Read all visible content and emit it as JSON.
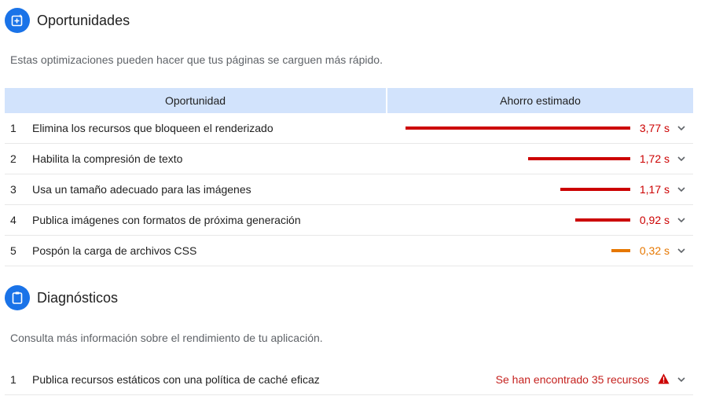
{
  "opportunities": {
    "title": "Oportunidades",
    "description": "Estas optimizaciones pueden hacer que tus páginas se carguen más rápido.",
    "col_opportunity": "Oportunidad",
    "col_saving": "Ahorro estimado",
    "icon": "opportunity-icon",
    "items": [
      {
        "num": "1",
        "title": "Elimina los recursos que bloqueen el renderizado",
        "value": "3,77 s",
        "seconds": 3.77,
        "color": "#cc0000"
      },
      {
        "num": "2",
        "title": "Habilita la compresión de texto",
        "value": "1,72 s",
        "seconds": 1.72,
        "color": "#cc0000"
      },
      {
        "num": "3",
        "title": "Usa un tamaño adecuado para las imágenes",
        "value": "1,17 s",
        "seconds": 1.17,
        "color": "#cc0000"
      },
      {
        "num": "4",
        "title": "Publica imágenes con formatos de próxima generación",
        "value": "0,92 s",
        "seconds": 0.92,
        "color": "#cc0000"
      },
      {
        "num": "5",
        "title": "Pospón la carga de archivos CSS",
        "value": "0,32 s",
        "seconds": 0.32,
        "color": "#e67700"
      }
    ]
  },
  "diagnostics": {
    "title": "Diagnósticos",
    "description": "Consulta más información sobre el rendimiento de tu aplicación.",
    "icon": "clipboard-icon",
    "items": [
      {
        "num": "1",
        "title": "Publica recursos estáticos con una política de caché eficaz",
        "status": "Se han encontrado 35 recursos",
        "status_color": "#c5221f"
      }
    ]
  },
  "colors": {
    "accent": "#1a73e8",
    "header_bg": "#d2e3fc",
    "fail": "#cc0000",
    "average": "#e67700"
  }
}
